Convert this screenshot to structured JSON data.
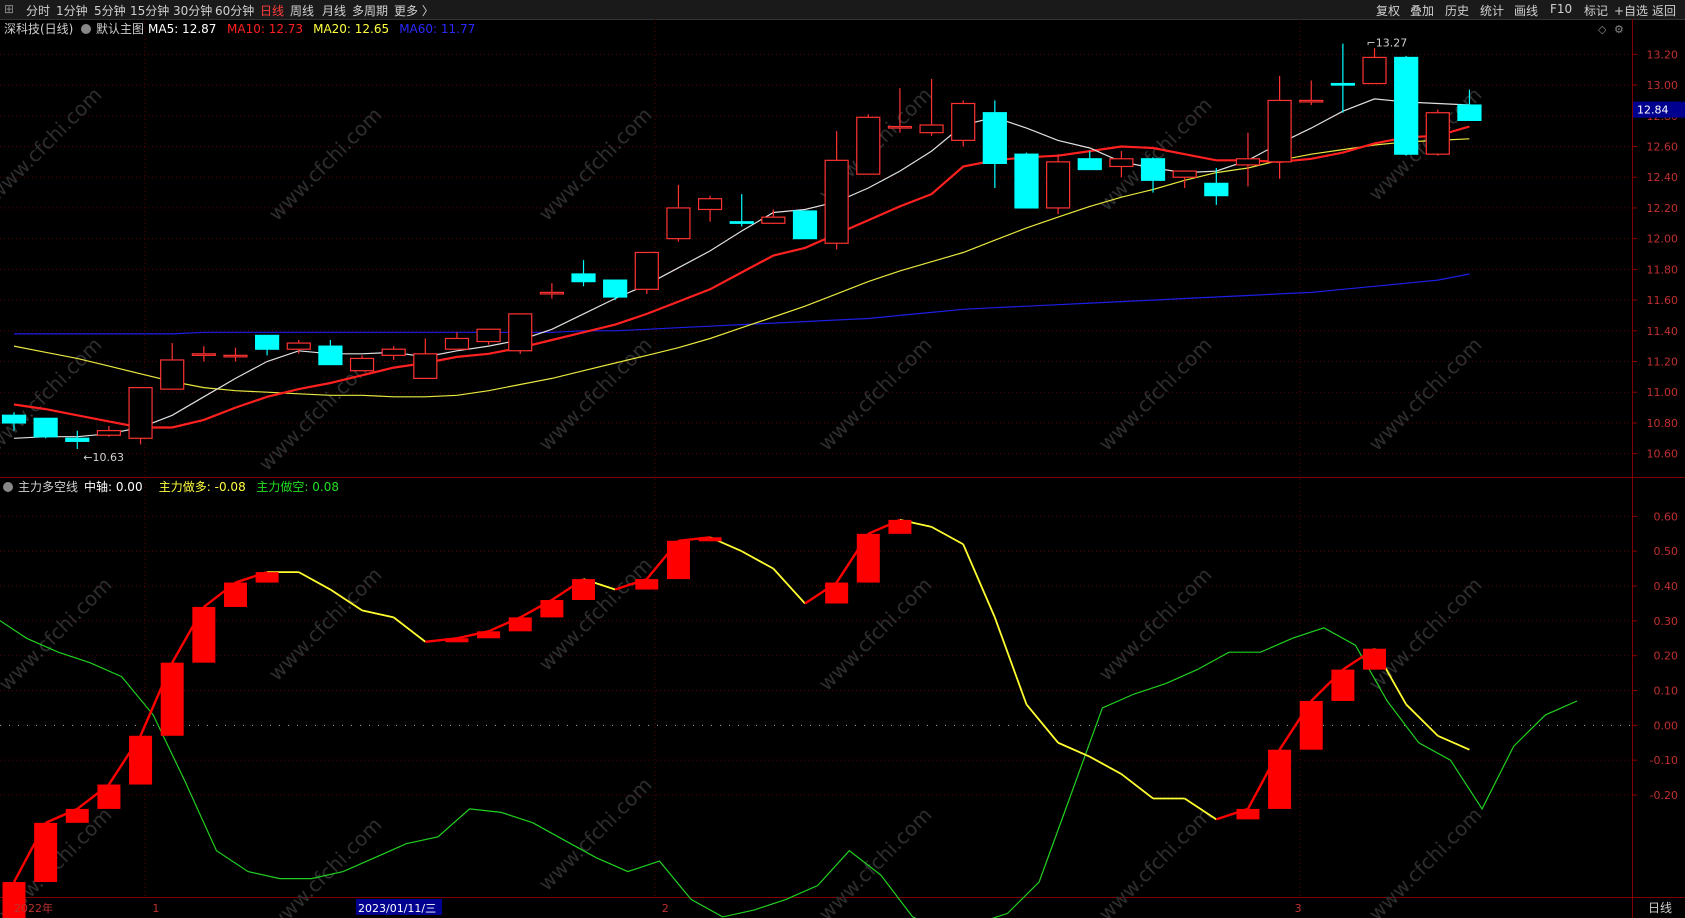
{
  "toolbar": {
    "periods": [
      "分时",
      "1分钟",
      "5分钟",
      "15分钟",
      "30分钟",
      "60分钟",
      "日线",
      "周线",
      "月线",
      "多周期",
      "更多 〉"
    ],
    "active_period": "日线",
    "right_buttons": [
      "复权",
      "叠加",
      "历史",
      "统计",
      "画线",
      "F10",
      "标记",
      "+自选",
      "返回"
    ]
  },
  "main_panel": {
    "stock_label": "深科技(日线)",
    "template_label": "默认主图",
    "ma_legend": [
      {
        "label": "MA5: 12.87",
        "color": "#ffffff"
      },
      {
        "label": "MA10: 12.73",
        "color": "#ff2020"
      },
      {
        "label": "MA20: 12.65",
        "color": "#ffff40"
      },
      {
        "label": "MA60: 11.77",
        "color": "#2828ff"
      }
    ],
    "price_axis": [
      "13.20",
      "13.00",
      "12.80",
      "12.60",
      "12.40",
      "12.20",
      "12.00",
      "11.80",
      "11.60",
      "11.40",
      "11.20",
      "11.00",
      "10.80",
      "10.60"
    ],
    "current_price": "12.84",
    "high_label": "13.27",
    "low_label": "10.63"
  },
  "sub_panel": {
    "indicator_name": "主力多空线",
    "legend": [
      {
        "label": "中轴: 0.00",
        "color": "#ffffff"
      },
      {
        "label": "主力做多: -0.08",
        "color": "#ffff40"
      },
      {
        "label": "主力做空: 0.08",
        "color": "#20e020"
      }
    ],
    "axis": [
      "0.60",
      "0.50",
      "0.40",
      "0.30",
      "0.20",
      "0.10",
      "0.00",
      "-0.10",
      "-0.20"
    ]
  },
  "time_axis": {
    "labels": [
      {
        "text": "2022年",
        "i": 0
      },
      {
        "text": "1",
        "i": 4.5
      },
      {
        "text": "2023/01/11/三",
        "i": 11,
        "highlight": true
      },
      {
        "text": "2",
        "i": 20.6
      },
      {
        "text": "3",
        "i": 40.6
      }
    ],
    "period_label": "日线"
  },
  "watermark": "www.cfchi.com",
  "colors": {
    "up": "#ff3232",
    "down": "#00ffff",
    "ma5": "#e0e0e0",
    "ma10": "#ff2020",
    "ma20": "#e8e840",
    "ma60": "#1e1ee6",
    "bull": "#ffff30",
    "bear": "#20d020",
    "block": "#ff0000"
  },
  "chart_data": {
    "type": "candlestick",
    "price_range": [
      10.5,
      13.3
    ],
    "candles": [
      [
        10.85,
        10.8,
        10.87,
        10.75
      ],
      [
        10.83,
        10.71,
        10.83,
        10.7
      ],
      [
        10.7,
        10.68,
        10.75,
        10.63
      ],
      [
        10.72,
        10.75,
        10.78,
        10.71
      ],
      [
        10.7,
        11.03,
        11.03,
        10.66
      ],
      [
        11.02,
        11.21,
        11.32,
        11.02
      ],
      [
        11.24,
        11.25,
        11.3,
        11.2
      ],
      [
        11.24,
        11.24,
        11.29,
        11.2
      ],
      [
        11.37,
        11.28,
        11.37,
        11.24
      ],
      [
        11.28,
        11.32,
        11.34,
        11.25
      ],
      [
        11.3,
        11.18,
        11.34,
        11.18
      ],
      [
        11.14,
        11.22,
        11.24,
        11.14
      ],
      [
        11.24,
        11.28,
        11.3,
        11.21
      ],
      [
        11.09,
        11.25,
        11.35,
        11.1
      ],
      [
        11.28,
        11.35,
        11.39,
        11.28
      ],
      [
        11.33,
        11.41,
        11.41,
        11.31
      ],
      [
        11.27,
        11.51,
        11.51,
        11.25
      ],
      [
        11.64,
        11.65,
        11.71,
        11.61
      ],
      [
        11.77,
        11.72,
        11.86,
        11.69
      ],
      [
        11.73,
        11.62,
        11.72,
        11.6
      ],
      [
        11.67,
        11.91,
        11.91,
        11.64
      ],
      [
        12.0,
        12.2,
        12.35,
        11.98
      ],
      [
        12.19,
        12.26,
        12.28,
        12.11
      ],
      [
        12.11,
        12.1,
        12.29,
        12.08
      ],
      [
        12.1,
        12.14,
        12.19,
        12.12
      ],
      [
        12.18,
        12.0,
        12.18,
        12.0
      ],
      [
        11.97,
        12.51,
        12.7,
        11.93
      ],
      [
        12.42,
        12.79,
        12.81,
        12.42
      ],
      [
        12.73,
        12.73,
        12.98,
        12.69
      ],
      [
        12.69,
        12.74,
        13.04,
        12.67
      ],
      [
        12.64,
        12.88,
        12.9,
        12.6
      ],
      [
        12.82,
        12.49,
        12.9,
        12.33
      ],
      [
        12.55,
        12.2,
        12.56,
        12.2
      ],
      [
        12.2,
        12.5,
        12.55,
        12.16
      ],
      [
        12.52,
        12.45,
        12.57,
        12.45
      ],
      [
        12.47,
        12.52,
        12.57,
        12.4
      ],
      [
        12.52,
        12.38,
        12.53,
        12.3
      ],
      [
        12.4,
        12.44,
        12.44,
        12.33
      ],
      [
        12.36,
        12.28,
        12.46,
        12.22
      ],
      [
        12.48,
        12.52,
        12.69,
        12.34
      ],
      [
        12.5,
        12.9,
        13.06,
        12.39
      ],
      [
        12.9,
        12.9,
        13.03,
        12.87
      ],
      [
        13.01,
        13.0,
        13.27,
        12.82
      ],
      [
        13.01,
        13.18,
        13.24,
        13.01
      ],
      [
        13.18,
        12.55,
        13.19,
        12.54
      ],
      [
        12.55,
        12.82,
        12.84,
        12.54
      ],
      [
        12.87,
        12.77,
        12.97,
        12.77
      ]
    ],
    "ma5": [
      10.7,
      10.71,
      10.71,
      10.73,
      10.77,
      10.85,
      10.97,
      11.09,
      11.2,
      11.27,
      11.25,
      11.25,
      11.26,
      11.23,
      11.27,
      11.3,
      11.34,
      11.41,
      11.51,
      11.61,
      11.7,
      11.81,
      11.92,
      12.05,
      12.17,
      12.19,
      12.24,
      12.33,
      12.44,
      12.57,
      12.74,
      12.79,
      12.72,
      12.64,
      12.59,
      12.5,
      12.46,
      12.43,
      12.44,
      12.51,
      12.62,
      12.72,
      12.83,
      12.91,
      12.89,
      12.88,
      12.87
    ],
    "ma10": [
      10.92,
      10.89,
      10.85,
      10.81,
      10.77,
      10.77,
      10.82,
      10.9,
      10.97,
      11.02,
      11.06,
      11.11,
      11.16,
      11.19,
      11.23,
      11.25,
      11.29,
      11.34,
      11.39,
      11.44,
      11.51,
      11.59,
      11.67,
      11.78,
      11.89,
      11.94,
      12.03,
      12.12,
      12.21,
      12.29,
      12.47,
      12.51,
      12.53,
      12.54,
      12.57,
      12.6,
      12.59,
      12.55,
      12.51,
      12.51,
      12.5,
      12.52,
      12.56,
      12.62,
      12.66,
      12.67,
      12.73
    ],
    "ma20": [
      11.3,
      11.26,
      11.22,
      11.17,
      11.12,
      11.07,
      11.03,
      11.01,
      11.0,
      10.99,
      10.98,
      10.98,
      10.97,
      10.97,
      10.98,
      11.01,
      11.05,
      11.09,
      11.14,
      11.19,
      11.24,
      11.29,
      11.35,
      11.42,
      11.49,
      11.56,
      11.64,
      11.72,
      11.79,
      11.85,
      11.91,
      11.99,
      12.07,
      12.14,
      12.21,
      12.27,
      12.32,
      12.38,
      12.43,
      12.46,
      12.51,
      12.55,
      12.58,
      12.61,
      12.63,
      12.64,
      12.65
    ],
    "ma60": [
      11.38,
      11.38,
      11.38,
      11.38,
      11.38,
      11.38,
      11.39,
      11.39,
      11.39,
      11.39,
      11.39,
      11.39,
      11.39,
      11.39,
      11.39,
      11.39,
      11.39,
      11.39,
      11.4,
      11.4,
      11.41,
      11.42,
      11.43,
      11.44,
      11.45,
      11.46,
      11.47,
      11.48,
      11.5,
      11.52,
      11.54,
      11.55,
      11.56,
      11.57,
      11.58,
      11.59,
      11.6,
      11.61,
      11.62,
      11.63,
      11.64,
      11.65,
      11.67,
      11.69,
      11.71,
      11.73,
      11.77
    ],
    "indicator_range": [
      -0.47,
      0.65
    ],
    "bull": [
      -0.45,
      -0.28,
      -0.24,
      -0.17,
      -0.03,
      0.18,
      0.34,
      0.41,
      0.44,
      0.44,
      0.39,
      0.33,
      0.31,
      0.24,
      0.25,
      0.27,
      0.31,
      0.36,
      0.42,
      0.39,
      0.42,
      0.53,
      0.54,
      0.5,
      0.45,
      0.35,
      0.41,
      0.55,
      0.59,
      0.57,
      0.52,
      0.31,
      0.06,
      -0.05,
      -0.09,
      -0.14,
      -0.21,
      -0.21,
      -0.27,
      -0.24,
      -0.07,
      0.07,
      0.16,
      0.22,
      0.06,
      -0.03,
      -0.07
    ],
    "bear": [
      0.31,
      0.25,
      0.21,
      0.18,
      0.14,
      0.03,
      -0.16,
      -0.36,
      -0.42,
      -0.44,
      -0.44,
      -0.42,
      -0.38,
      -0.34,
      -0.32,
      -0.24,
      -0.25,
      -0.28,
      -0.33,
      -0.38,
      -0.42,
      -0.39,
      -0.5,
      -0.55,
      -0.53,
      -0.5,
      -0.46,
      -0.36,
      -0.43,
      -0.55,
      -0.59,
      -0.57,
      -0.54,
      -0.45,
      -0.2,
      0.05,
      0.09,
      0.12,
      0.16,
      0.21,
      0.21,
      0.25,
      0.28,
      0.23,
      0.07,
      -0.05,
      -0.1,
      -0.24,
      -0.06,
      0.03,
      0.07
    ]
  }
}
